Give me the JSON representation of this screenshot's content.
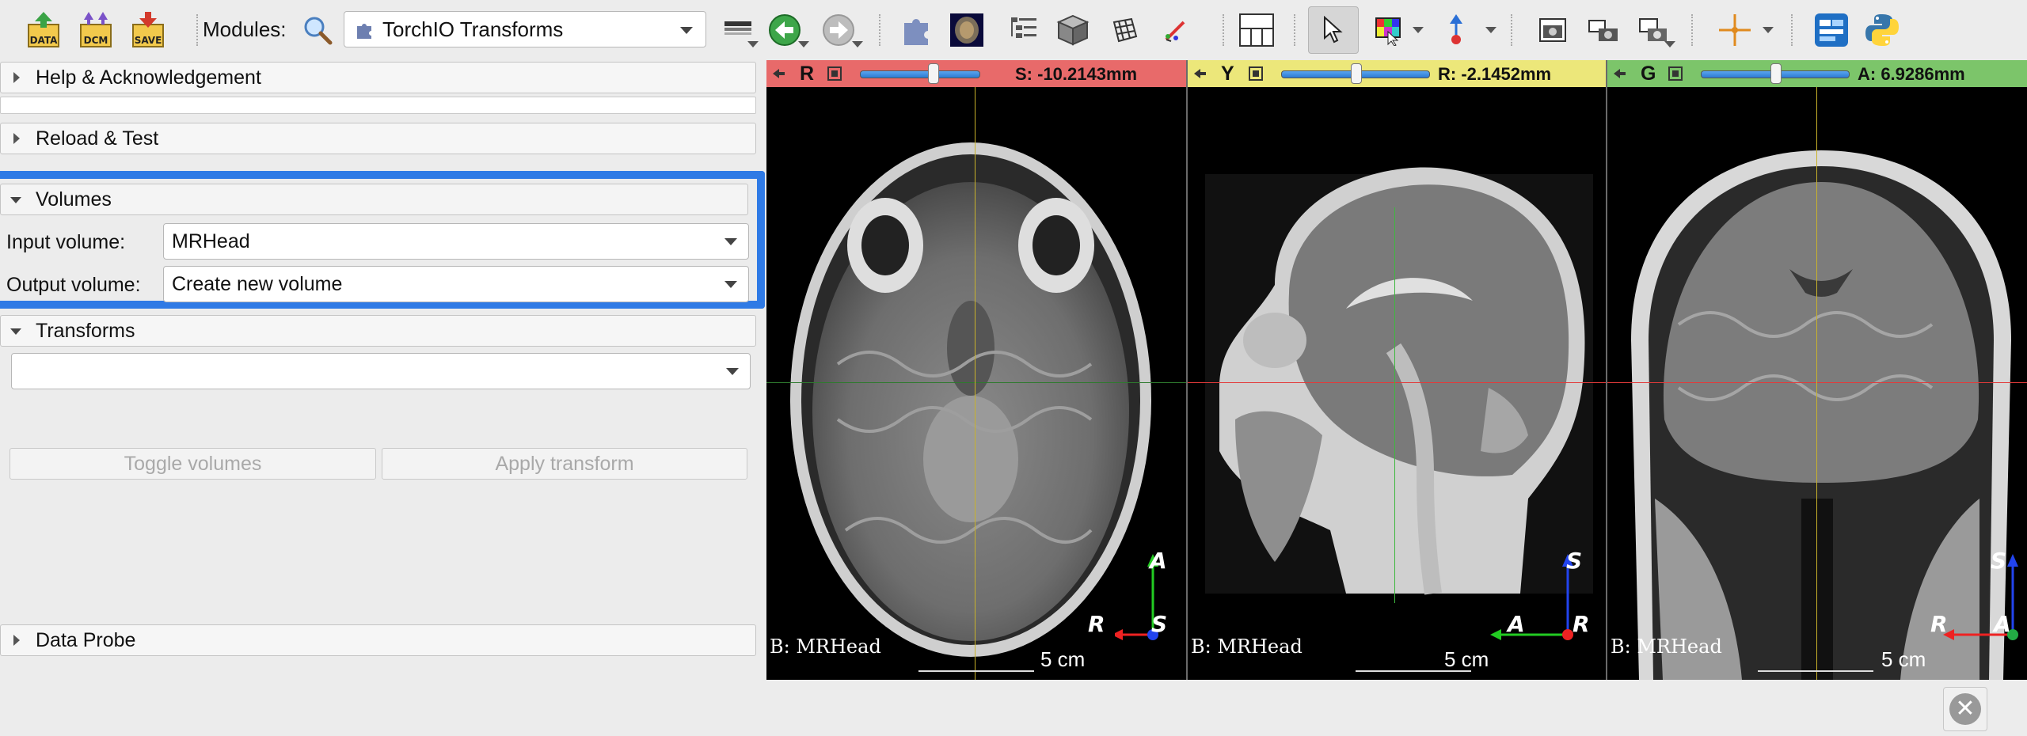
{
  "toolbar": {
    "data_label": "DATA",
    "dcm_label": "DCM",
    "save_label": "SAVE",
    "modules_label": "Modules:",
    "module_selected": "TorchIO Transforms"
  },
  "panel": {
    "help_section": "Help & Acknowledgement",
    "reload_section": "Reload & Test",
    "volumes_section": "Volumes",
    "input_volume_label": "Input volume:",
    "input_volume_value": "MRHead",
    "output_volume_label": "Output volume:",
    "output_volume_value": "Create new volume",
    "transforms_section": "Transforms",
    "transform_value": "",
    "toggle_button": "Toggle volumes",
    "apply_button": "Apply transform",
    "data_probe_section": "Data Probe"
  },
  "views": {
    "red": {
      "letter": "R",
      "coord": "S: -10.2143mm",
      "slider_fraction": 0.5,
      "label": "B: MRHead",
      "scale": "5 cm",
      "orient_v": "A",
      "orient_h": "R",
      "orient_c": "S",
      "bar_color": "#e86a6a"
    },
    "yellow": {
      "letter": "Y",
      "coord": "R: -2.1452mm",
      "slider_fraction": 0.5,
      "label": "B: MRHead",
      "scale": "5 cm",
      "orient_v": "S",
      "orient_h": "A",
      "orient_c": "R",
      "bar_color": "#ece77a"
    },
    "green": {
      "letter": "G",
      "coord": "A: 6.9286mm",
      "slider_fraction": 0.5,
      "label": "B: MRHead",
      "scale": "5 cm",
      "orient_v": "S",
      "orient_h": "R",
      "orient_c": "A",
      "bar_color": "#7cc56a"
    }
  },
  "colors": {
    "highlight": "#2f7ae5",
    "crosshair_h": "#ff3030",
    "crosshair_v_red": "#e8d23a",
    "crosshair_v_yellow": "#4ec04e"
  }
}
